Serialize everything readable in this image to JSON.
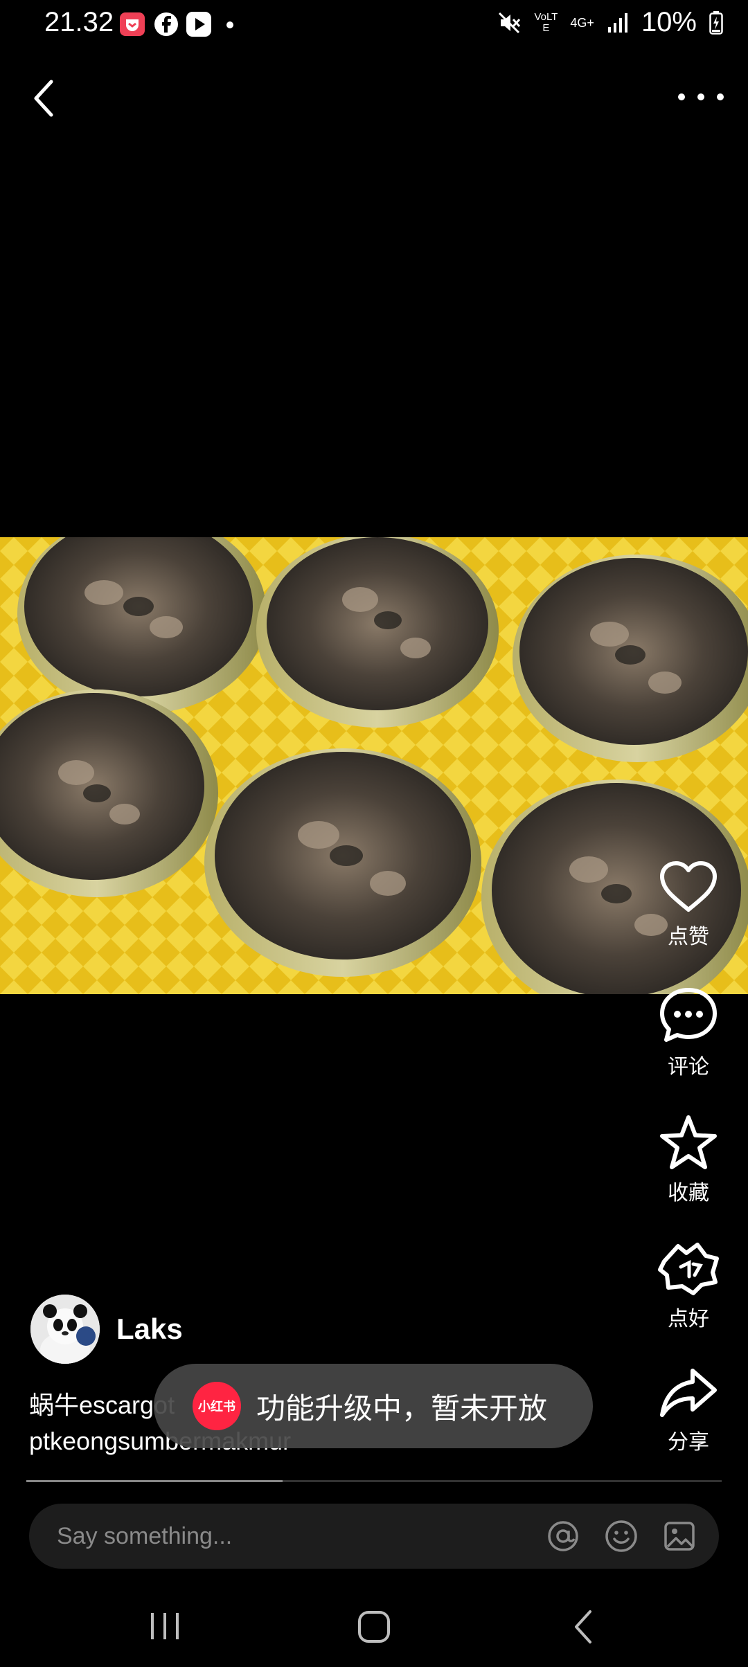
{
  "status_bar": {
    "time": "21.32",
    "network_top": "VoLTE",
    "network_4g": "4G+",
    "battery": "10%"
  },
  "post": {
    "author_name": "Laks",
    "caption_line1": "蜗牛escargot",
    "caption_line2": "ptkeongsumbermakmur",
    "toast_logo": "小红书",
    "toast_text": "功能升级中，暂未开放"
  },
  "actions": [
    {
      "icon": "heart-icon",
      "label": "点赞"
    },
    {
      "icon": "comment-icon",
      "label": "评论"
    },
    {
      "icon": "star-icon",
      "label": "收藏"
    },
    {
      "icon": "like-good-icon",
      "label": "点好"
    },
    {
      "icon": "share-icon",
      "label": "分享"
    }
  ],
  "comment_bar": {
    "placeholder": "Say something..."
  },
  "colors": {
    "background": "#000000",
    "toast_bg": "#464646",
    "brand_red": "#ff2442",
    "photo_tray": "#e7be1a"
  }
}
